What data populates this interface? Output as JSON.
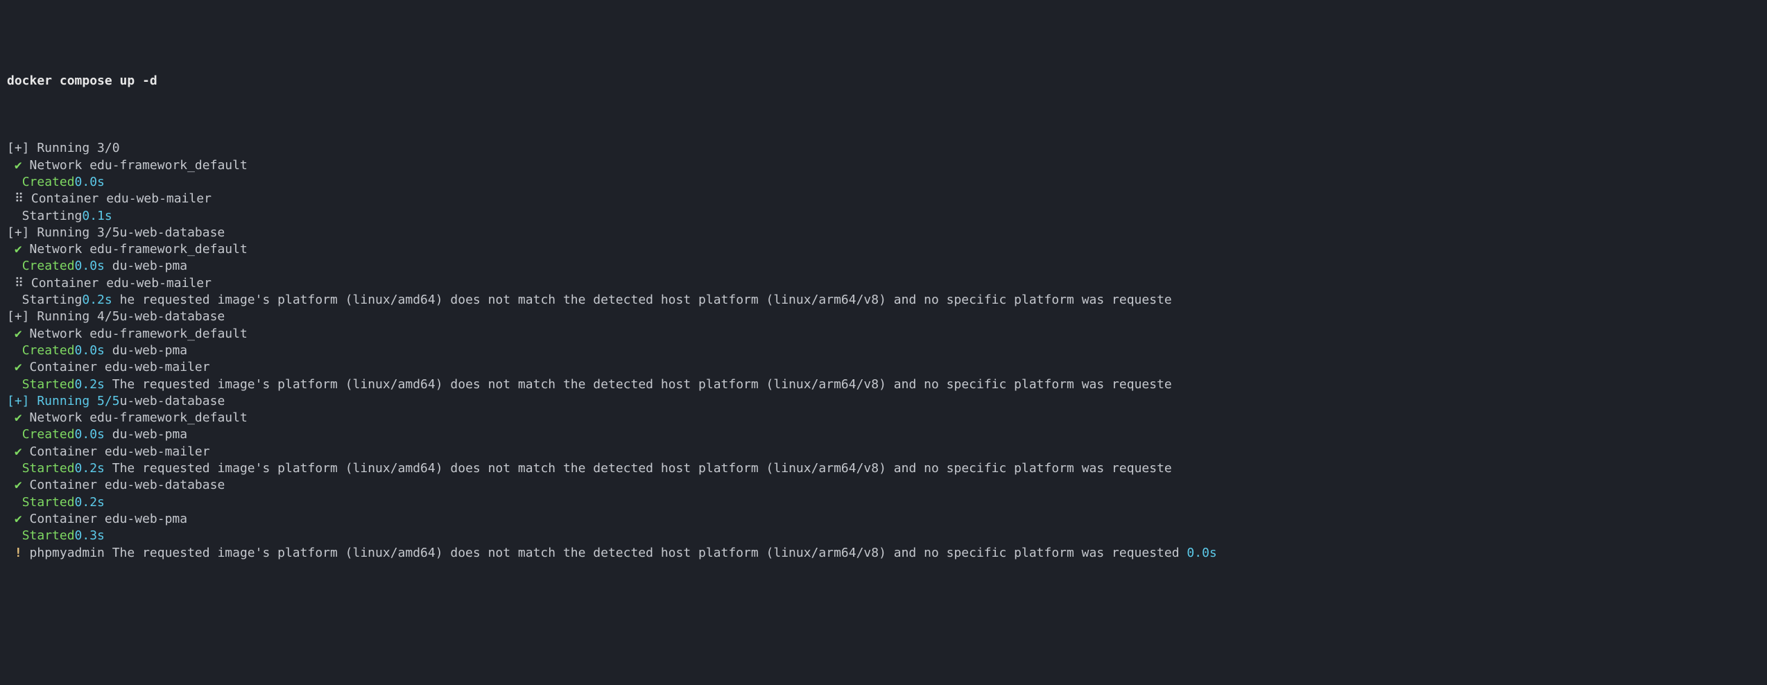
{
  "command": "docker compose up -d",
  "blank": " ",
  "lines": [
    {
      "segs": [
        {
          "cls": "",
          "t": "[+] Running 3/0"
        }
      ]
    },
    {
      "segs": [
        {
          "cls": "check",
          "t": " ✔ "
        },
        {
          "cls": "",
          "t": "Network edu-framework_default"
        }
      ]
    },
    {
      "segs": [
        {
          "cls": "",
          "t": "  "
        },
        {
          "cls": "green",
          "t": "Created"
        },
        {
          "cls": "cyan",
          "t": "0.0s"
        }
      ]
    },
    {
      "segs": [
        {
          "cls": "spinner",
          "t": " ⠿ "
        },
        {
          "cls": "",
          "t": "Container edu-web-mailer"
        }
      ]
    },
    {
      "segs": [
        {
          "cls": "",
          "t": "  Starting"
        },
        {
          "cls": "cyan",
          "t": "0.1s"
        }
      ]
    },
    {
      "segs": [
        {
          "cls": "",
          "t": "[+] Running 3/5u-web-database"
        }
      ]
    },
    {
      "segs": [
        {
          "cls": "check",
          "t": " ✔ "
        },
        {
          "cls": "",
          "t": "Network edu-framework_default"
        }
      ]
    },
    {
      "segs": [
        {
          "cls": "",
          "t": "  "
        },
        {
          "cls": "green",
          "t": "Created"
        },
        {
          "cls": "cyan",
          "t": "0.0s"
        },
        {
          "cls": "",
          "t": " du-web-pma"
        }
      ]
    },
    {
      "segs": [
        {
          "cls": "spinner",
          "t": " ⠿ "
        },
        {
          "cls": "",
          "t": "Container edu-web-mailer"
        }
      ]
    },
    {
      "segs": [
        {
          "cls": "",
          "t": "  Starting"
        },
        {
          "cls": "cyan",
          "t": "0.2s"
        },
        {
          "cls": "",
          "t": " he requested image's platform (linux/amd64) does not match the detected host platform (linux/arm64/v8) and no specific platform was requeste"
        }
      ]
    },
    {
      "segs": [
        {
          "cls": "",
          "t": "[+] Running 4/5u-web-database"
        }
      ]
    },
    {
      "segs": [
        {
          "cls": "check",
          "t": " ✔ "
        },
        {
          "cls": "",
          "t": "Network edu-framework_default"
        }
      ]
    },
    {
      "segs": [
        {
          "cls": "",
          "t": "  "
        },
        {
          "cls": "green",
          "t": "Created"
        },
        {
          "cls": "cyan",
          "t": "0.0s"
        },
        {
          "cls": "",
          "t": " du-web-pma"
        }
      ]
    },
    {
      "segs": [
        {
          "cls": "check",
          "t": " ✔ "
        },
        {
          "cls": "",
          "t": "Container edu-web-mailer"
        }
      ]
    },
    {
      "segs": [
        {
          "cls": "",
          "t": "  "
        },
        {
          "cls": "green",
          "t": "Started"
        },
        {
          "cls": "cyan",
          "t": "0.2s"
        },
        {
          "cls": "",
          "t": " The requested image's platform (linux/amd64) does not match the detected host platform (linux/arm64/v8) and no specific platform was requeste"
        }
      ]
    },
    {
      "segs": [
        {
          "cls": "cyan",
          "t": "[+] Running 5/5"
        },
        {
          "cls": "",
          "t": "u-web-database"
        }
      ]
    },
    {
      "segs": [
        {
          "cls": "check",
          "t": " ✔ "
        },
        {
          "cls": "",
          "t": "Network edu-framework_default"
        }
      ]
    },
    {
      "segs": [
        {
          "cls": "",
          "t": "  "
        },
        {
          "cls": "green",
          "t": "Created"
        },
        {
          "cls": "cyan",
          "t": "0.0s"
        },
        {
          "cls": "",
          "t": " du-web-pma"
        }
      ]
    },
    {
      "segs": [
        {
          "cls": "check",
          "t": " ✔ "
        },
        {
          "cls": "",
          "t": "Container edu-web-mailer"
        }
      ]
    },
    {
      "segs": [
        {
          "cls": "",
          "t": "  "
        },
        {
          "cls": "green",
          "t": "Started"
        },
        {
          "cls": "cyan",
          "t": "0.2s"
        },
        {
          "cls": "",
          "t": " The requested image's platform (linux/amd64) does not match the detected host platform (linux/arm64/v8) and no specific platform was requeste"
        }
      ]
    },
    {
      "segs": [
        {
          "cls": "check",
          "t": " ✔ "
        },
        {
          "cls": "",
          "t": "Container edu-web-database"
        }
      ]
    },
    {
      "segs": [
        {
          "cls": "",
          "t": "  "
        },
        {
          "cls": "green",
          "t": "Started"
        },
        {
          "cls": "cyan",
          "t": "0.2s"
        }
      ]
    },
    {
      "segs": [
        {
          "cls": "check",
          "t": " ✔ "
        },
        {
          "cls": "",
          "t": "Container edu-web-pma"
        }
      ]
    },
    {
      "segs": [
        {
          "cls": "",
          "t": "  "
        },
        {
          "cls": "green",
          "t": "Started"
        },
        {
          "cls": "cyan",
          "t": "0.3s"
        }
      ]
    },
    {
      "segs": [
        {
          "cls": "yellow",
          "t": " ! "
        },
        {
          "cls": "",
          "t": "phpmyadmin The requested image's platform (linux/amd64) does not match the detected host platform (linux/arm64/v8) and no specific platform was requested "
        },
        {
          "cls": "cyan",
          "t": "0.0s"
        }
      ]
    }
  ]
}
